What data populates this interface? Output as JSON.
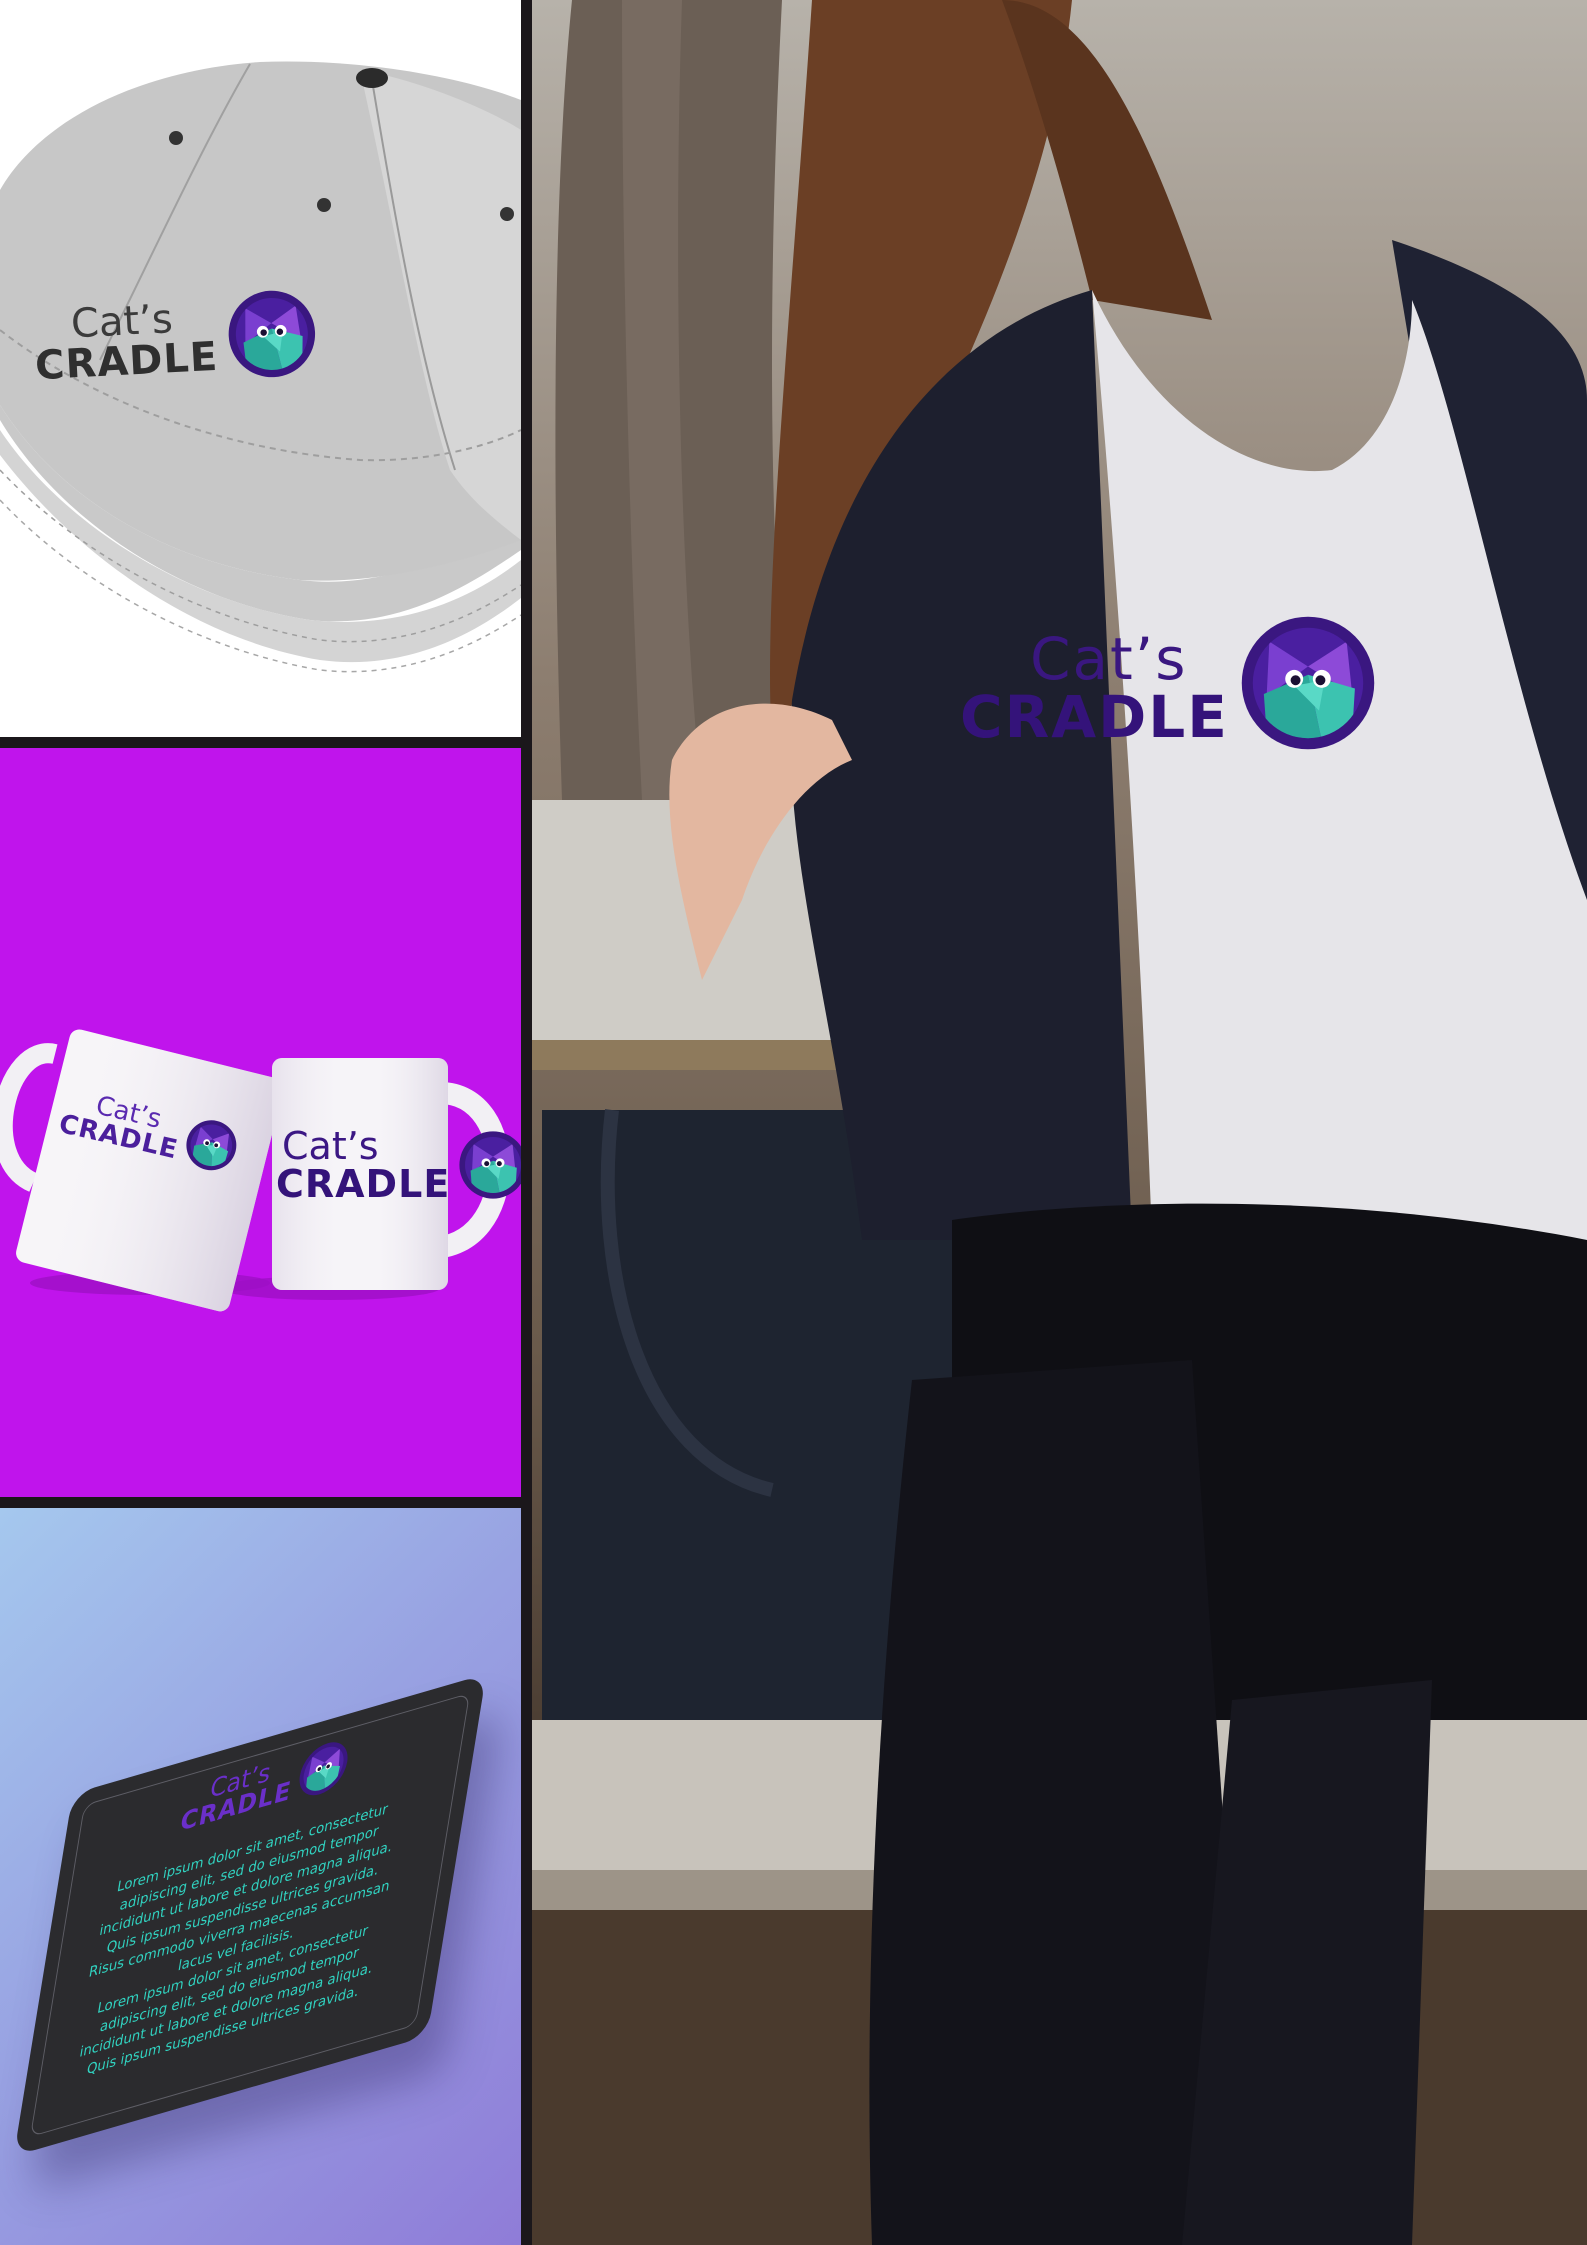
{
  "brand": {
    "line1": "Cat’s",
    "line2": "CRADLE",
    "colors": {
      "primary_purple": "#3a1780",
      "emblem_purple": "#6b2fc4",
      "emblem_teal": "#2fb8a8",
      "mug_background": "#c014ec",
      "coaster_text": "#31d3c1"
    }
  },
  "coaster": {
    "body_lines": [
      "Lorem ipsum dolor sit amet, consectetur",
      "adipiscing elit, sed do eiusmod tempor",
      "incididunt ut labore et dolore magna aliqua.",
      "Quis ipsum suspendisse ultrices gravida.",
      "Risus commodo viverra maecenas accumsan",
      "lacus vel facilisis.",
      "Lorem ipsum dolor sit amet, consectetur",
      "adipiscing elit, sed do eiusmod tempor",
      "incididunt ut labore et dolore magna aliqua.",
      "Quis ipsum suspendisse ultrices gravida."
    ]
  },
  "icons": {
    "emblem": "cat-emblem-icon"
  }
}
